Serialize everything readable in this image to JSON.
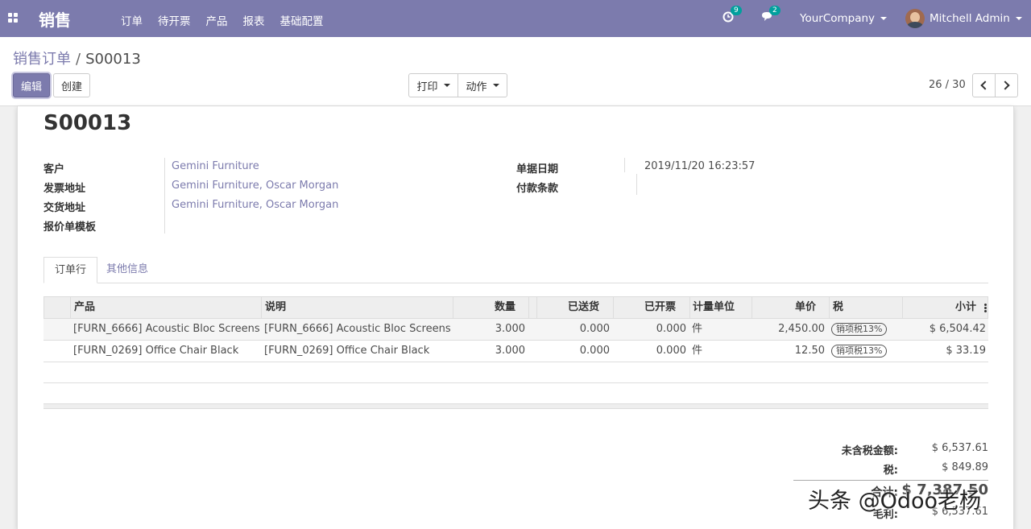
{
  "navbar": {
    "brand": "销售",
    "menu": [
      "订单",
      "待开票",
      "产品",
      "报表",
      "基础配置"
    ],
    "activity_count": "9",
    "message_count": "2",
    "company": "YourCompany",
    "user": "Mitchell Admin",
    "color": "#7c7bad"
  },
  "control": {
    "breadcrumb_parent": "销售订单",
    "breadcrumb_sep": "/",
    "breadcrumb_current": "S00013",
    "edit_label": "编辑",
    "create_label": "创建",
    "print_label": "打印",
    "action_label": "动作",
    "pager": "26 / 30"
  },
  "form": {
    "title": "S00013",
    "customer_label": "客户",
    "customer": "Gemini Furniture",
    "invoice_addr_label": "发票地址",
    "invoice_addr": "Gemini Furniture, Oscar Morgan",
    "delivery_addr_label": "交货地址",
    "delivery_addr": "Gemini Furniture, Oscar Morgan",
    "template_label": "报价单模板",
    "date_label": "单据日期",
    "date": "2019/11/20 16:23:57",
    "terms_label": "付款条款"
  },
  "tabs": [
    "订单行",
    "其他信息"
  ],
  "lines": {
    "headers": {
      "product": "产品",
      "description": "说明",
      "qty": "数量",
      "delivered": "已送货",
      "invoiced": "已开票",
      "uom": "计量单位",
      "price": "单价",
      "tax": "税",
      "subtotal": "小计"
    },
    "rows": [
      {
        "product": "[FURN_6666] Acoustic Bloc Screens",
        "description": "[FURN_6666] Acoustic Bloc Screens",
        "qty": "3.000",
        "delivered": "0.000",
        "invoiced": "0.000",
        "uom": "件",
        "price": "2,450.00",
        "tax": "销项税13%",
        "subtotal": "$ 6,504.42"
      },
      {
        "product": "[FURN_0269] Office Chair Black",
        "description": "[FURN_0269] Office Chair Black",
        "qty": "3.000",
        "delivered": "0.000",
        "invoiced": "0.000",
        "uom": "件",
        "price": "12.50",
        "tax": "销项税13%",
        "subtotal": "$ 33.19"
      }
    ]
  },
  "totals": {
    "untaxed_label": "未含税金额:",
    "untaxed": "$ 6,537.61",
    "tax_label": "税:",
    "tax": "$ 849.89",
    "total_label": "合计:",
    "total": "$ 7,387.50",
    "margin_label": "毛利:",
    "margin": "$ 6,537.61"
  },
  "watermark": "头条 @Odoo老杨"
}
